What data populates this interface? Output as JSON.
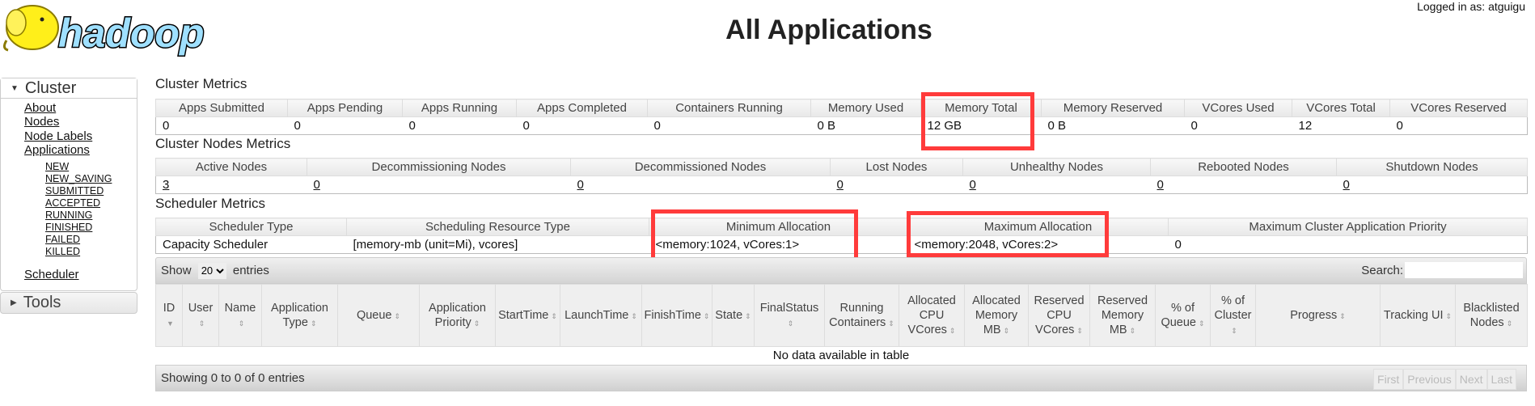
{
  "header": {
    "logo_text": "hadoop",
    "title": "All Applications",
    "logged_in": "Logged in as: atguigu"
  },
  "sidebar": {
    "cluster": "Cluster",
    "items": [
      "About",
      "Nodes",
      "Node Labels",
      "Applications"
    ],
    "app_states": [
      "NEW",
      "NEW_SAVING",
      "SUBMITTED",
      "ACCEPTED",
      "RUNNING",
      "FINISHED",
      "FAILED",
      "KILLED"
    ],
    "scheduler": "Scheduler",
    "tools": "Tools"
  },
  "cluster_metrics": {
    "title": "Cluster Metrics",
    "headers": [
      "Apps Submitted",
      "Apps Pending",
      "Apps Running",
      "Apps Completed",
      "Containers Running",
      "Memory Used",
      "Memory Total",
      "Memory Reserved",
      "VCores Used",
      "VCores Total",
      "VCores Reserved"
    ],
    "values": [
      "0",
      "0",
      "0",
      "0",
      "0",
      "0 B",
      "12 GB",
      "0 B",
      "0",
      "12",
      "0"
    ]
  },
  "nodes_metrics": {
    "title": "Cluster Nodes Metrics",
    "headers": [
      "Active Nodes",
      "Decommissioning Nodes",
      "Decommissioned Nodes",
      "Lost Nodes",
      "Unhealthy Nodes",
      "Rebooted Nodes",
      "Shutdown Nodes"
    ],
    "values": [
      "3",
      "0",
      "0",
      "0",
      "0",
      "0",
      "0"
    ]
  },
  "scheduler_metrics": {
    "title": "Scheduler Metrics",
    "headers": [
      "Scheduler Type",
      "Scheduling Resource Type",
      "Minimum Allocation",
      "Maximum Allocation",
      "Maximum Cluster Application Priority"
    ],
    "values": [
      "Capacity Scheduler",
      "[memory-mb (unit=Mi), vcores]",
      "<memory:1024, vCores:1>",
      "<memory:2048, vCores:2>",
      "0"
    ]
  },
  "apps_table": {
    "show_label": "Show",
    "entries_label": "entries",
    "page_size": "20",
    "search_label": "Search:",
    "search_value": "",
    "columns": [
      "ID",
      "User",
      "Name",
      "Application Type",
      "Queue",
      "Application Priority",
      "StartTime",
      "LaunchTime",
      "FinishTime",
      "State",
      "FinalStatus",
      "Running Containers",
      "Allocated CPU VCores",
      "Allocated Memory MB",
      "Reserved CPU VCores",
      "Reserved Memory MB",
      "% of Queue",
      "% of Cluster",
      "Progress",
      "Tracking UI",
      "Blacklisted Nodes"
    ],
    "empty": "No data available in table",
    "info": "Showing 0 to 0 of 0 entries",
    "pager": [
      "First",
      "Previous",
      "Next",
      "Last"
    ]
  },
  "colors": {
    "highlight": "#ff3b3b"
  }
}
